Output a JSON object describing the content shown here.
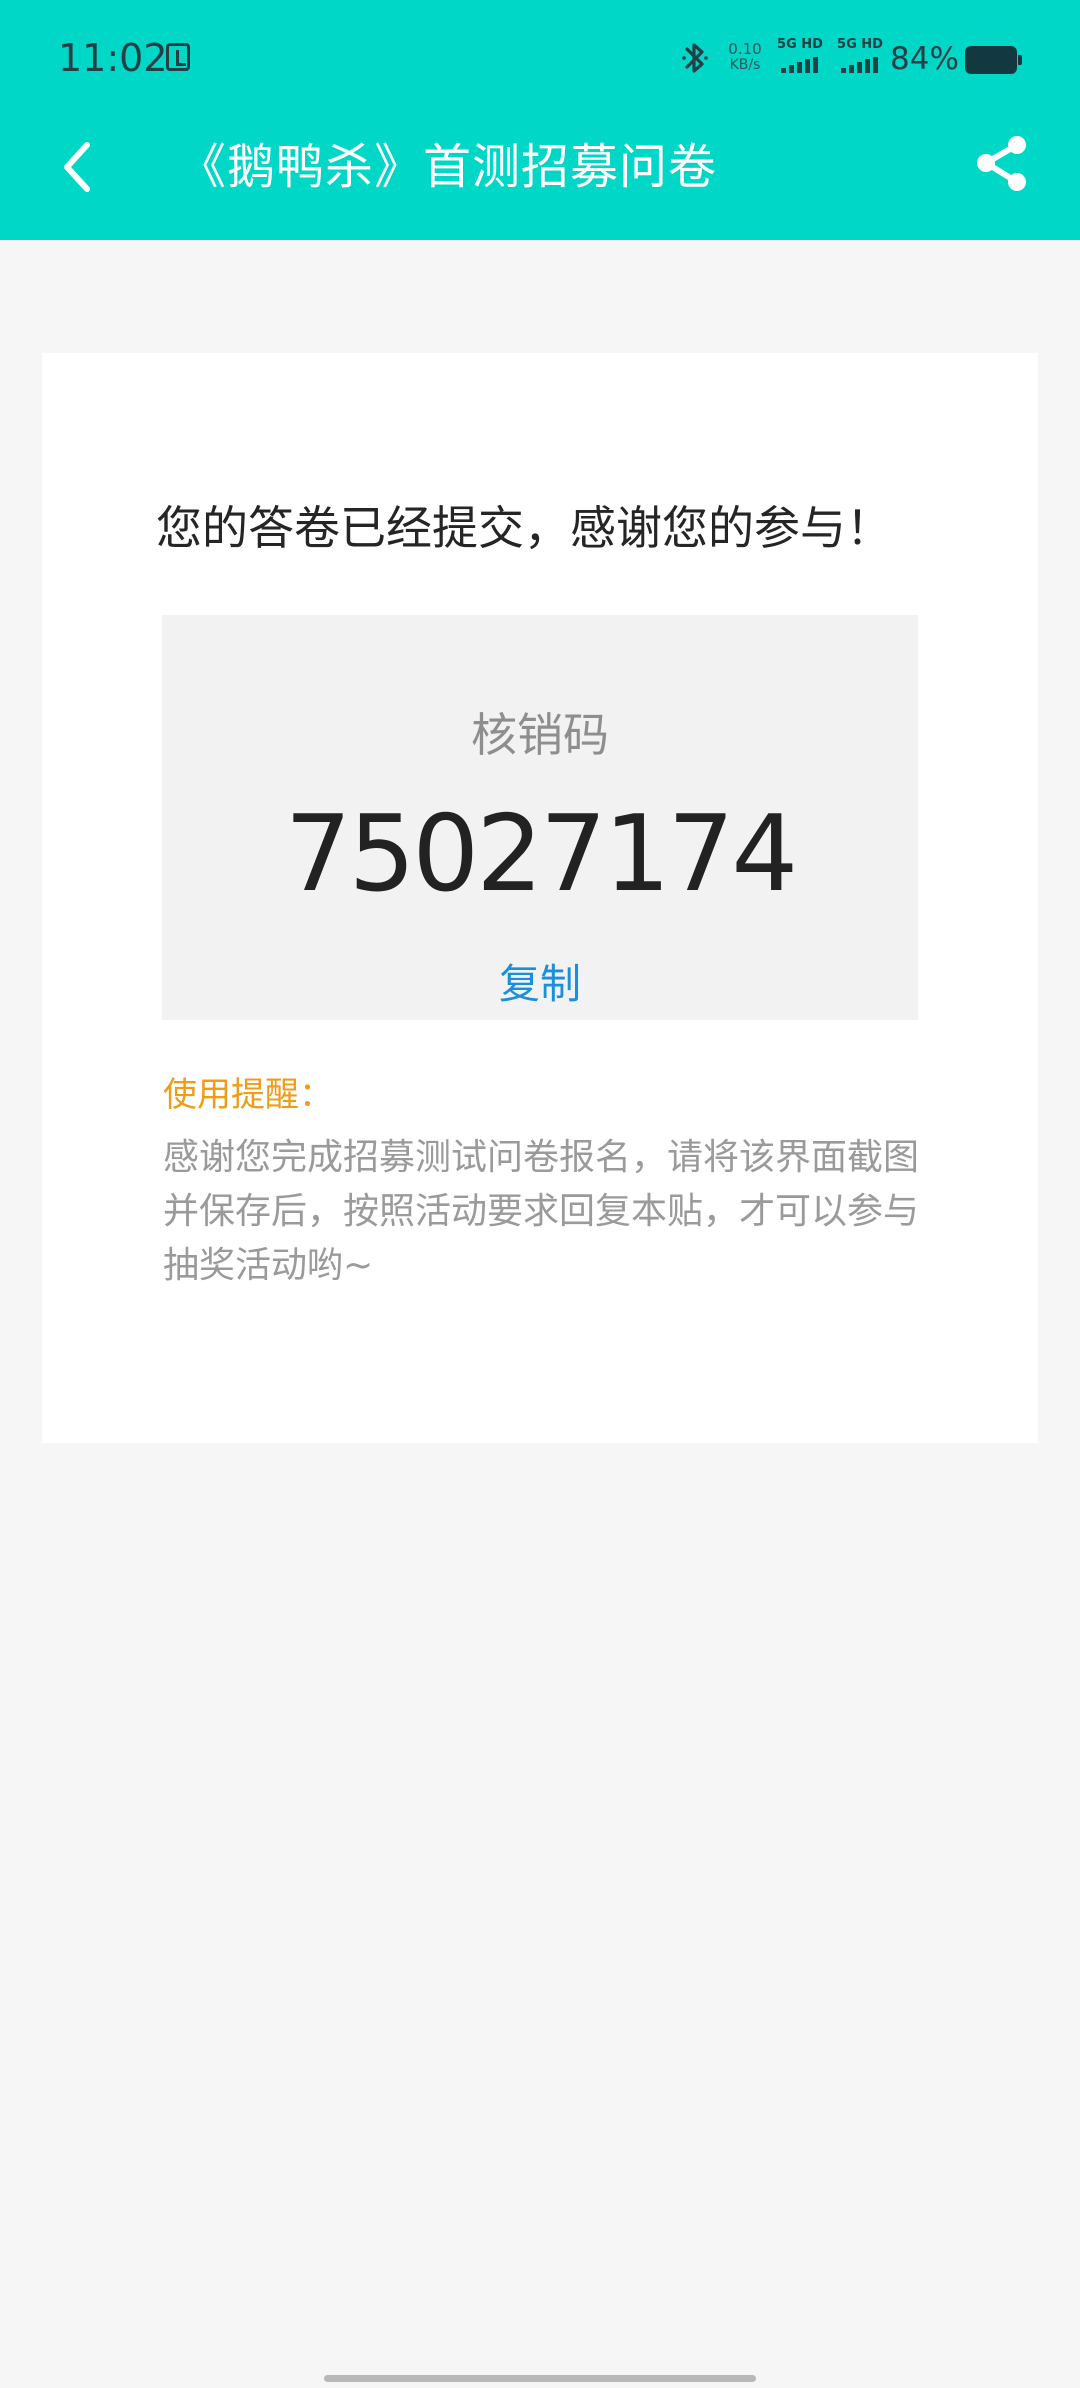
{
  "status_bar": {
    "time": "11:02",
    "network_speed_value": "0.10",
    "network_speed_unit": "KB/s",
    "signal_1_label": "5G HD",
    "signal_2_label": "5G HD",
    "battery_percent": "84%",
    "icons": {
      "notification": "notification-app-icon",
      "bluetooth": "bluetooth-icon",
      "signal": "cell-signal-icon",
      "battery": "battery-icon"
    }
  },
  "header": {
    "title": "《鹅鸭杀》首测招募问卷",
    "back_icon": "back-chevron-icon",
    "share_icon": "share-icon"
  },
  "content": {
    "message": "您的答卷已经提交，感谢您的参与！",
    "code_label": "核销码",
    "verification_code": "75027174",
    "copy_label": "复制",
    "reminder_title": "使用提醒：",
    "reminder_lines": [
      "感谢您完成招募测试问卷报名，请将该界面截图",
      "并保存后，按照活动要求回复本贴，才可以参与",
      "抽奖活动哟~"
    ]
  },
  "colors": {
    "header": "#00d7c6",
    "page_background": "#f6f6f6",
    "card_background": "#ffffff",
    "code_box_background": "#f2f2f2",
    "primary_text": "#252525",
    "secondary_text": "#9a9a9a",
    "copy_link": "#1c8fdb",
    "reminder_title": "#ef9c19"
  }
}
